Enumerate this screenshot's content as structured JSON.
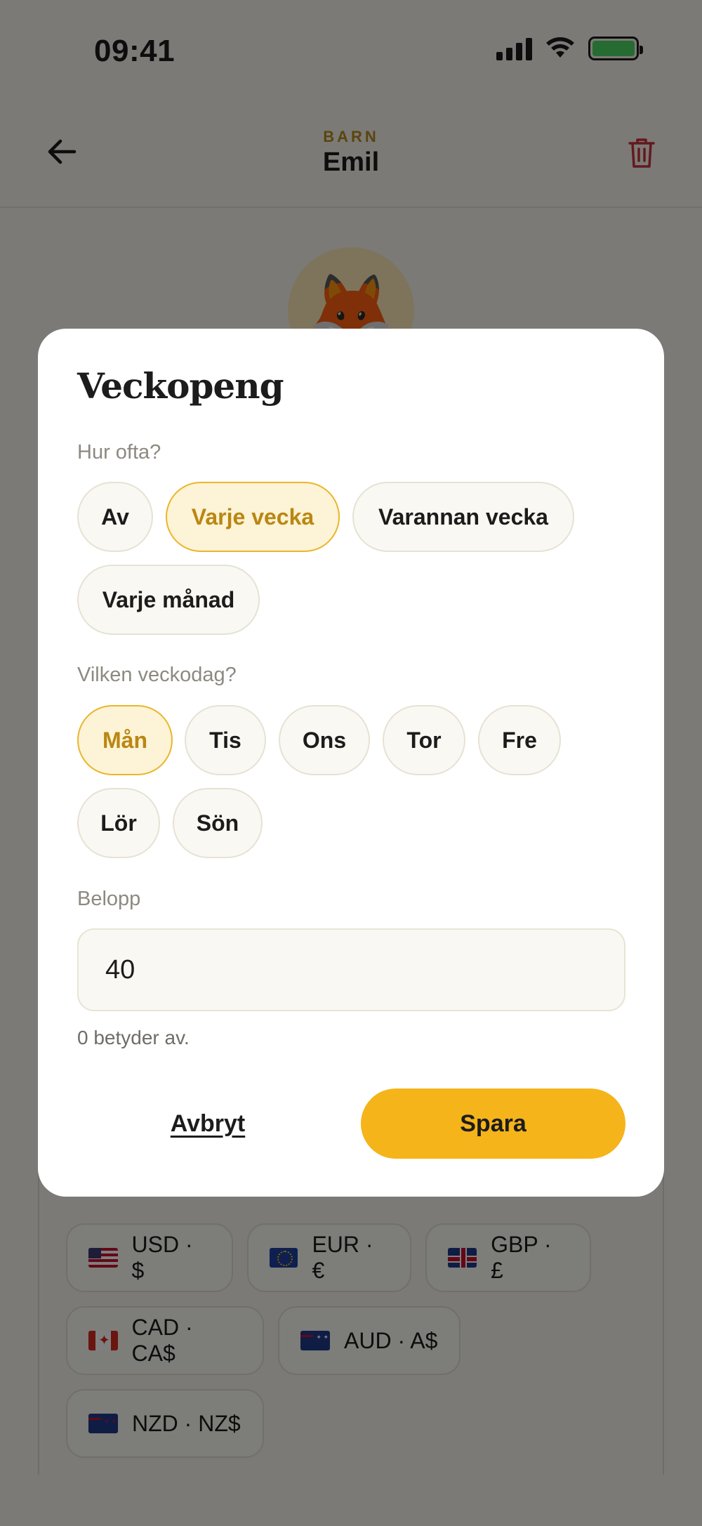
{
  "status_bar": {
    "time": "09:41"
  },
  "header": {
    "eyebrow": "BARN",
    "title": "Emil"
  },
  "avatar": {
    "emoji": "🦊"
  },
  "currencies": [
    {
      "label": "USD · $",
      "flag": "us-flag"
    },
    {
      "label": "EUR · €",
      "flag": "eu-flag"
    },
    {
      "label": "GBP · £",
      "flag": "gb-flag"
    },
    {
      "label": "CAD · CA$",
      "flag": "ca-flag"
    },
    {
      "label": "AUD · A$",
      "flag": "au-flag"
    },
    {
      "label": "NZD · NZ$",
      "flag": "nz-flag"
    }
  ],
  "modal": {
    "title": "Veckopeng",
    "frequency_label": "Hur ofta?",
    "frequency_options": [
      "Av",
      "Varje vecka",
      "Varannan vecka",
      "Varje månad"
    ],
    "frequency_selected": "Varje vecka",
    "weekday_label": "Vilken veckodag?",
    "weekday_options": [
      "Mån",
      "Tis",
      "Ons",
      "Tor",
      "Fre",
      "Lör",
      "Sön"
    ],
    "weekday_selected": "Mån",
    "amount_label": "Belopp",
    "amount_value": "40",
    "hint": "0 betyder av.",
    "cancel_label": "Avbryt",
    "save_label": "Spara"
  },
  "colors": {
    "accent": "#f5b41a",
    "accent_text": "#b98712",
    "delete_red": "#c8323a",
    "eyebrow": "#b48a1a"
  }
}
